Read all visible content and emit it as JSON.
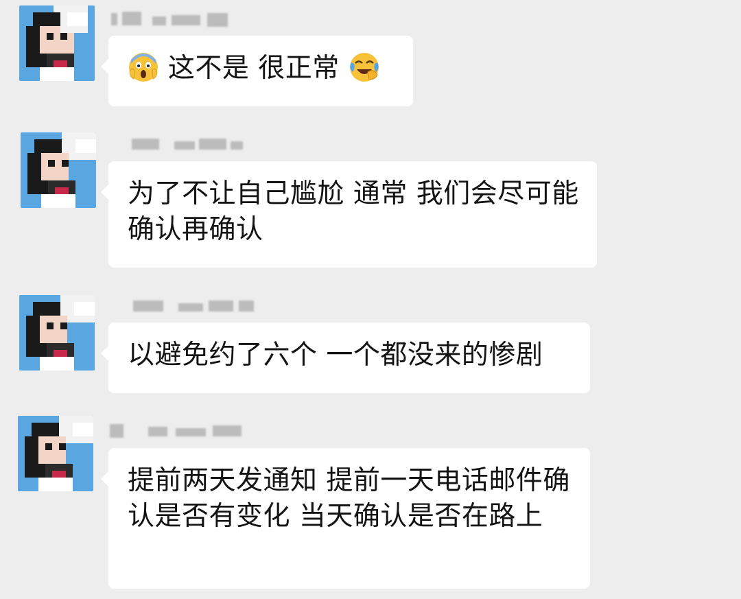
{
  "messages": [
    {
      "sender": "",
      "segments": {
        "emoji_start": "scream-emoji",
        "text": "这不是 很正常",
        "emoji_end": "laughing-crying-emoji"
      }
    },
    {
      "sender": "",
      "text": "为了不让自己尴尬 通常 我们会尽可能确认再确认"
    },
    {
      "sender": "",
      "text": "以避免约了六个 一个都没来的惨剧"
    },
    {
      "sender": "",
      "text": "提前两天发通知 提前一天电话邮件确认是否有变化 当天确认是否在路上"
    }
  ],
  "colors": {
    "background": "#ededed",
    "bubble": "#ffffff",
    "text": "#141414",
    "avatar_bg": "#5aa6e0"
  }
}
